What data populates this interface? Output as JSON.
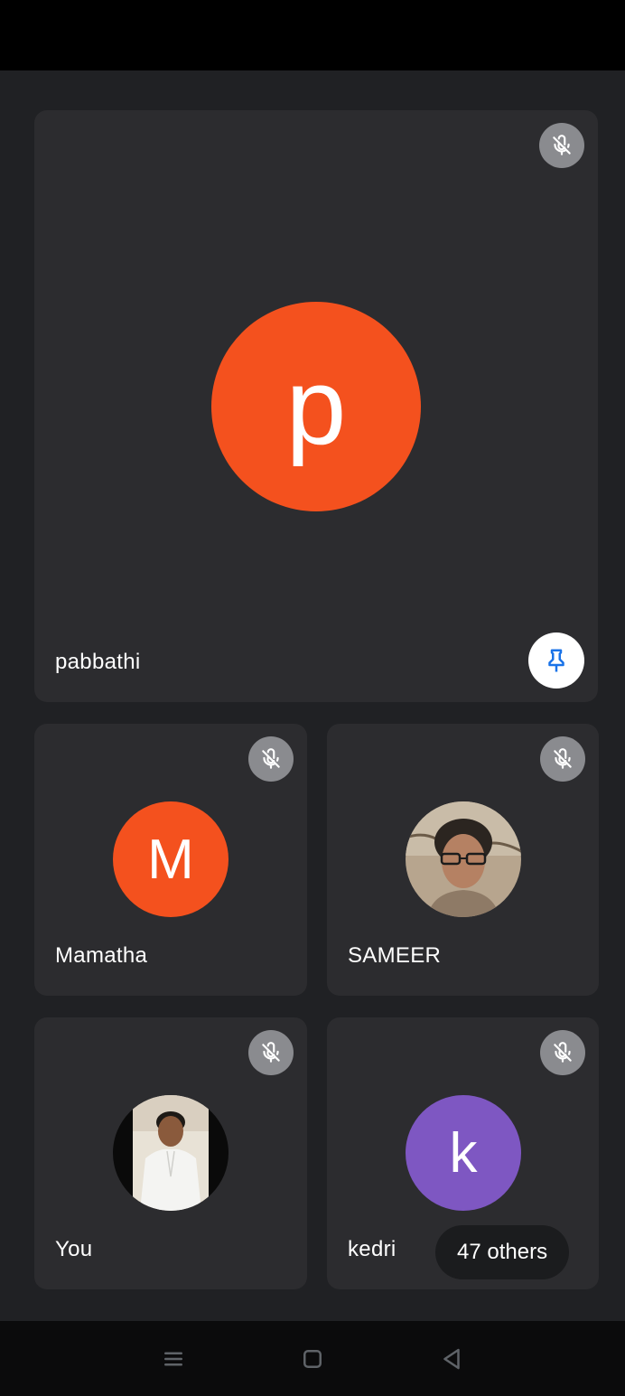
{
  "colors": {
    "orange_avatar": "#f4511e",
    "purple_avatar": "#7e57c2",
    "pin_blue": "#1a73e8"
  },
  "main_tile": {
    "name": "pabbathi",
    "initial": "p",
    "muted_icon": "mic-off-icon",
    "pin_icon": "pin-icon"
  },
  "participants": [
    {
      "name": "Mamatha",
      "initial": "M",
      "type": "initial"
    },
    {
      "name": "SAMEER",
      "type": "photo"
    },
    {
      "name": "You",
      "type": "photo"
    },
    {
      "name": "kedri",
      "initial": "k",
      "type": "initial"
    }
  ],
  "others_chip": {
    "label": "47 others"
  },
  "nav": {
    "icons": [
      "menu-icon",
      "home-icon",
      "back-icon"
    ]
  }
}
